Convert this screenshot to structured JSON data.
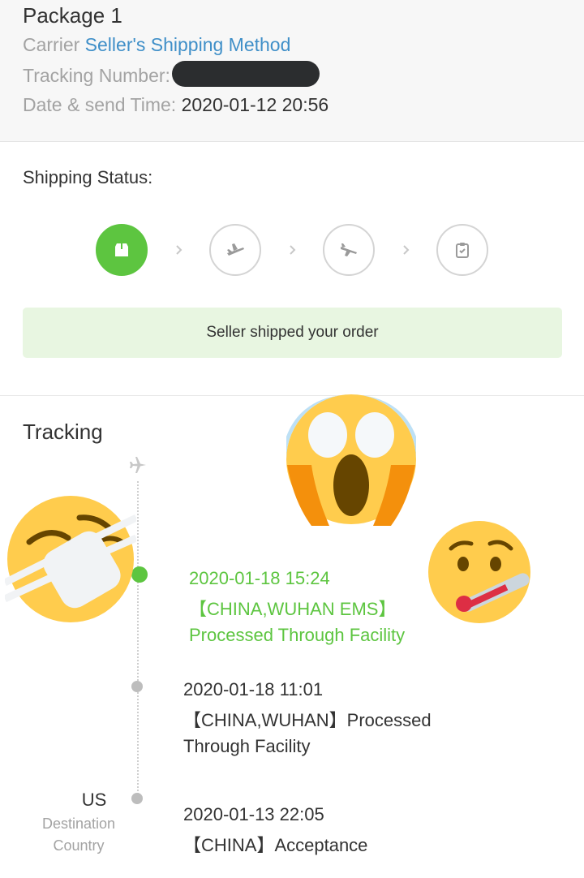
{
  "package": {
    "title": "Package 1",
    "carrier_label": "Carrier",
    "carrier_value": "Seller's Shipping Method",
    "tracking_label": "Tracking Number:",
    "date_label": "Date & send Time:",
    "date_value": "2020-01-12 20:56"
  },
  "shipping_status": {
    "title": "Shipping Status:",
    "steps": [
      {
        "icon": "package-icon",
        "active": true
      },
      {
        "icon": "airplane-takeoff-icon",
        "active": false
      },
      {
        "icon": "airplane-landing-icon",
        "active": false
      },
      {
        "icon": "clipboard-check-icon",
        "active": false
      }
    ],
    "banner": "Seller shipped your order"
  },
  "tracking": {
    "title": "Tracking",
    "events": [
      {
        "time": "2020-01-18 15:24",
        "desc": "【CHINA,WUHAN EMS】Processed Through Facility",
        "highlight": true
      },
      {
        "time": "2020-01-18 11:01",
        "desc": "【CHINA,WUHAN】Processed Through Facility",
        "highlight": false
      },
      {
        "time": "2020-01-13 22:05",
        "desc": "【CHINA】Acceptance",
        "highlight": false
      }
    ],
    "destination": {
      "country": "US",
      "label": "Destination Country"
    }
  },
  "colors": {
    "accent_green": "#5dc540",
    "link_blue": "#3f8fc8",
    "banner_bg": "#e8f6e1"
  },
  "overlays": [
    "face-with-medical-mask-emoji",
    "face-screaming-in-fear-emoji",
    "face-with-thermometer-emoji"
  ]
}
